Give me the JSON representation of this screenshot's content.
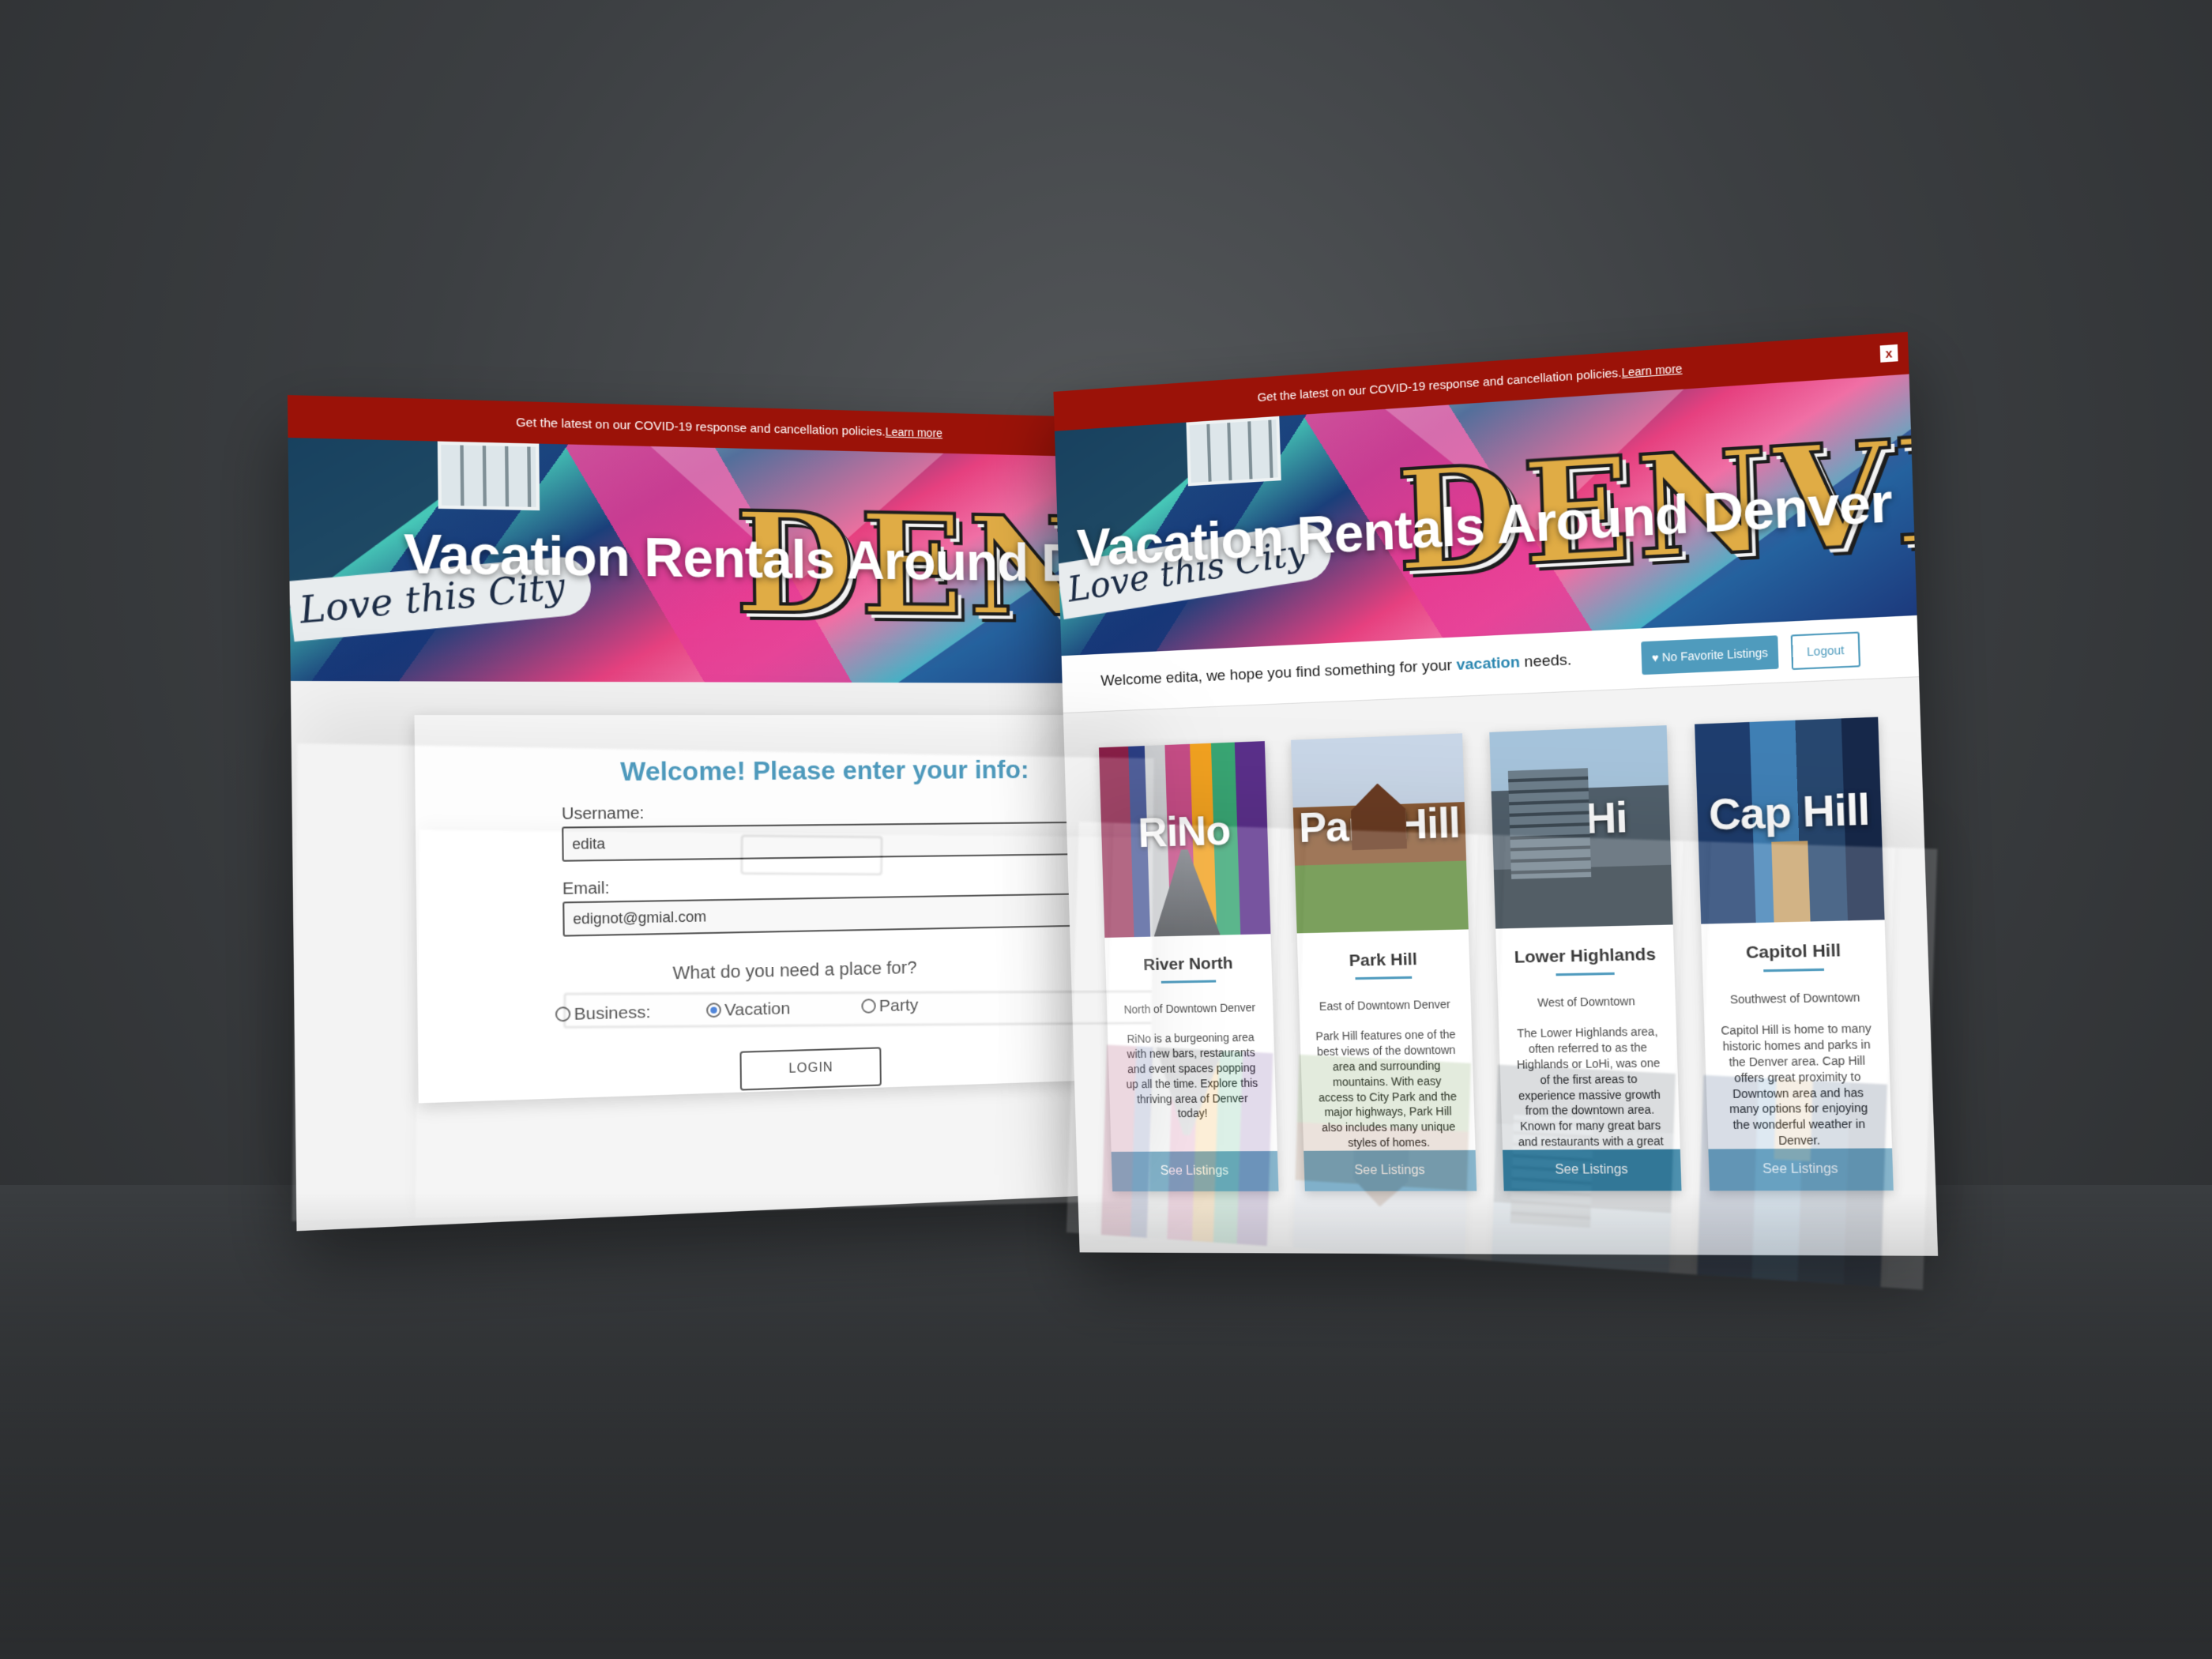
{
  "covid_banner": {
    "text": "Get the latest on our COVID-19 response and cancellation policies.",
    "link": "Learn more",
    "close": "x"
  },
  "hero": {
    "title": "Vacation Rentals Around Denver",
    "left_title": "Vacation Rentals Around D",
    "mural_script": "Love this City",
    "mural_word": "DENVER",
    "left_mural_word": "DENV"
  },
  "login": {
    "heading": "Welcome! Please enter your info:",
    "username_label": "Username:",
    "username_value": "edita",
    "email_label": "Email:",
    "email_value": "edignot@gmial.com",
    "question": "What do you need a place for?",
    "options": [
      "Business:",
      "Vacation",
      "Party"
    ],
    "selected": "Vacation",
    "button": "LOGIN"
  },
  "listings": {
    "welcome_prefix": "Welcome edita, we hope you find something for your ",
    "welcome_accent": "vacation",
    "welcome_suffix": " needs.",
    "favorites_button": "♥ No Favorite Listings",
    "logout_button": "Logout",
    "cards": [
      {
        "tag": "RiNo",
        "title": "River North",
        "subtitle": "North of Downtown Denver",
        "description": "RiNo is a burgeoning area with new bars, restaurants and event spaces popping up all the time. Explore this thriving area of Denver today!",
        "button": "See Listings"
      },
      {
        "tag": "Park Hill",
        "title": "Park Hill",
        "subtitle": "East of Downtown Denver",
        "description": "Park Hill features one of the best views of the downtown area and surrounding mountains. With easy access to City Park and the major highways, Park Hill also includes many unique styles of homes.",
        "button": "See Listings"
      },
      {
        "tag": "LoHi",
        "title": "Lower Highlands",
        "subtitle": "West of Downtown",
        "description": "The Lower Highlands area, often referred to as the Highlands or LoHi, was one of the first areas to experience massive growth from the downtown area. Known for many great bars and restaurants with a great eastern facing view of the Downtown area.",
        "button": "See Listings"
      },
      {
        "tag": "Cap Hill",
        "title": "Capitol Hill",
        "subtitle": "Southwest of Downtown",
        "description": "Capitol Hill is home to many historic homes and parks in the Denver area. Cap Hill offers great proximity to Downtown area and has many options for enjoying the wonderful weather in Denver.",
        "button": "See Listings"
      }
    ]
  },
  "colors": {
    "banner_red": "#9b1208",
    "accent_blue": "#2a86b0",
    "button_blue": "#6fa8c4",
    "button_active": "#2a7ca0"
  }
}
